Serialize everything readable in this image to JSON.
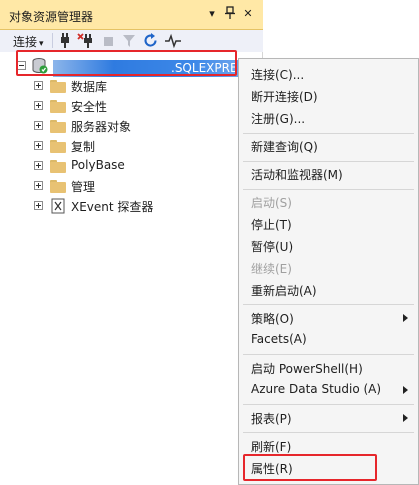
{
  "panel": {
    "title": "对象资源管理器",
    "pin_glyph": "▾",
    "autohide_glyph": "⊥",
    "close_glyph": "✕"
  },
  "toolbar": {
    "connect_label": "连接",
    "connect_caret": "▾"
  },
  "tree": {
    "server_name": ".SQLEXPRESS",
    "items": [
      {
        "label": "数据库",
        "icon": "folder-icon"
      },
      {
        "label": "安全性",
        "icon": "folder-icon"
      },
      {
        "label": "服务器对象",
        "icon": "folder-icon"
      },
      {
        "label": "复制",
        "icon": "folder-icon"
      },
      {
        "label": "PolyBase",
        "icon": "folder-icon"
      },
      {
        "label": "管理",
        "icon": "folder-icon"
      },
      {
        "label": "XEvent 探查器",
        "icon": "xevent-icon"
      }
    ]
  },
  "context_menu": {
    "items": [
      {
        "label": "连接(C)...",
        "disabled": false
      },
      {
        "label": "断开连接(D)",
        "disabled": false
      },
      {
        "label": "注册(G)...",
        "disabled": false
      },
      {
        "label": "新建查询(Q)",
        "disabled": false
      },
      {
        "label": "活动和监视器(M)",
        "disabled": false
      },
      {
        "label": "启动(S)",
        "disabled": true
      },
      {
        "label": "停止(T)",
        "disabled": false
      },
      {
        "label": "暂停(U)",
        "disabled": false
      },
      {
        "label": "继续(E)",
        "disabled": true
      },
      {
        "label": "重新启动(A)",
        "disabled": false
      },
      {
        "label": "策略(O)",
        "submenu": true
      },
      {
        "label": "Facets(A)",
        "disabled": false
      },
      {
        "label": "启动 PowerShell(H)",
        "disabled": false
      },
      {
        "label": "Azure Data Studio (A)",
        "submenu": true
      },
      {
        "label": "报表(P)",
        "submenu": true
      },
      {
        "label": "刷新(F)",
        "disabled": false
      },
      {
        "label": "属性(R)",
        "disabled": false
      }
    ]
  },
  "colors": {
    "title_bg": "#ffe8a6",
    "toolbar_bg": "#eef0f8",
    "highlight": "#e6262b",
    "menu_bg": "#f5f5f5"
  }
}
